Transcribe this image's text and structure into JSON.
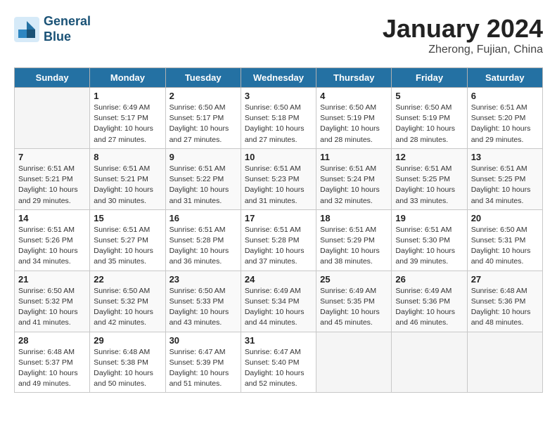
{
  "header": {
    "logo_line1": "General",
    "logo_line2": "Blue",
    "month": "January 2024",
    "location": "Zherong, Fujian, China"
  },
  "weekdays": [
    "Sunday",
    "Monday",
    "Tuesday",
    "Wednesday",
    "Thursday",
    "Friday",
    "Saturday"
  ],
  "weeks": [
    [
      {
        "day": "",
        "empty": true
      },
      {
        "day": "1",
        "sunrise": "6:49 AM",
        "sunset": "5:17 PM",
        "daylight": "10 hours and 27 minutes."
      },
      {
        "day": "2",
        "sunrise": "6:50 AM",
        "sunset": "5:17 PM",
        "daylight": "10 hours and 27 minutes."
      },
      {
        "day": "3",
        "sunrise": "6:50 AM",
        "sunset": "5:18 PM",
        "daylight": "10 hours and 27 minutes."
      },
      {
        "day": "4",
        "sunrise": "6:50 AM",
        "sunset": "5:19 PM",
        "daylight": "10 hours and 28 minutes."
      },
      {
        "day": "5",
        "sunrise": "6:50 AM",
        "sunset": "5:19 PM",
        "daylight": "10 hours and 28 minutes."
      },
      {
        "day": "6",
        "sunrise": "6:51 AM",
        "sunset": "5:20 PM",
        "daylight": "10 hours and 29 minutes."
      }
    ],
    [
      {
        "day": "7",
        "sunrise": "6:51 AM",
        "sunset": "5:21 PM",
        "daylight": "10 hours and 29 minutes."
      },
      {
        "day": "8",
        "sunrise": "6:51 AM",
        "sunset": "5:21 PM",
        "daylight": "10 hours and 30 minutes."
      },
      {
        "day": "9",
        "sunrise": "6:51 AM",
        "sunset": "5:22 PM",
        "daylight": "10 hours and 31 minutes."
      },
      {
        "day": "10",
        "sunrise": "6:51 AM",
        "sunset": "5:23 PM",
        "daylight": "10 hours and 31 minutes."
      },
      {
        "day": "11",
        "sunrise": "6:51 AM",
        "sunset": "5:24 PM",
        "daylight": "10 hours and 32 minutes."
      },
      {
        "day": "12",
        "sunrise": "6:51 AM",
        "sunset": "5:25 PM",
        "daylight": "10 hours and 33 minutes."
      },
      {
        "day": "13",
        "sunrise": "6:51 AM",
        "sunset": "5:25 PM",
        "daylight": "10 hours and 34 minutes."
      }
    ],
    [
      {
        "day": "14",
        "sunrise": "6:51 AM",
        "sunset": "5:26 PM",
        "daylight": "10 hours and 34 minutes."
      },
      {
        "day": "15",
        "sunrise": "6:51 AM",
        "sunset": "5:27 PM",
        "daylight": "10 hours and 35 minutes."
      },
      {
        "day": "16",
        "sunrise": "6:51 AM",
        "sunset": "5:28 PM",
        "daylight": "10 hours and 36 minutes."
      },
      {
        "day": "17",
        "sunrise": "6:51 AM",
        "sunset": "5:28 PM",
        "daylight": "10 hours and 37 minutes."
      },
      {
        "day": "18",
        "sunrise": "6:51 AM",
        "sunset": "5:29 PM",
        "daylight": "10 hours and 38 minutes."
      },
      {
        "day": "19",
        "sunrise": "6:51 AM",
        "sunset": "5:30 PM",
        "daylight": "10 hours and 39 minutes."
      },
      {
        "day": "20",
        "sunrise": "6:50 AM",
        "sunset": "5:31 PM",
        "daylight": "10 hours and 40 minutes."
      }
    ],
    [
      {
        "day": "21",
        "sunrise": "6:50 AM",
        "sunset": "5:32 PM",
        "daylight": "10 hours and 41 minutes."
      },
      {
        "day": "22",
        "sunrise": "6:50 AM",
        "sunset": "5:32 PM",
        "daylight": "10 hours and 42 minutes."
      },
      {
        "day": "23",
        "sunrise": "6:50 AM",
        "sunset": "5:33 PM",
        "daylight": "10 hours and 43 minutes."
      },
      {
        "day": "24",
        "sunrise": "6:49 AM",
        "sunset": "5:34 PM",
        "daylight": "10 hours and 44 minutes."
      },
      {
        "day": "25",
        "sunrise": "6:49 AM",
        "sunset": "5:35 PM",
        "daylight": "10 hours and 45 minutes."
      },
      {
        "day": "26",
        "sunrise": "6:49 AM",
        "sunset": "5:36 PM",
        "daylight": "10 hours and 46 minutes."
      },
      {
        "day": "27",
        "sunrise": "6:48 AM",
        "sunset": "5:36 PM",
        "daylight": "10 hours and 48 minutes."
      }
    ],
    [
      {
        "day": "28",
        "sunrise": "6:48 AM",
        "sunset": "5:37 PM",
        "daylight": "10 hours and 49 minutes."
      },
      {
        "day": "29",
        "sunrise": "6:48 AM",
        "sunset": "5:38 PM",
        "daylight": "10 hours and 50 minutes."
      },
      {
        "day": "30",
        "sunrise": "6:47 AM",
        "sunset": "5:39 PM",
        "daylight": "10 hours and 51 minutes."
      },
      {
        "day": "31",
        "sunrise": "6:47 AM",
        "sunset": "5:40 PM",
        "daylight": "10 hours and 52 minutes."
      },
      {
        "day": "",
        "empty": true
      },
      {
        "day": "",
        "empty": true
      },
      {
        "day": "",
        "empty": true
      }
    ]
  ]
}
